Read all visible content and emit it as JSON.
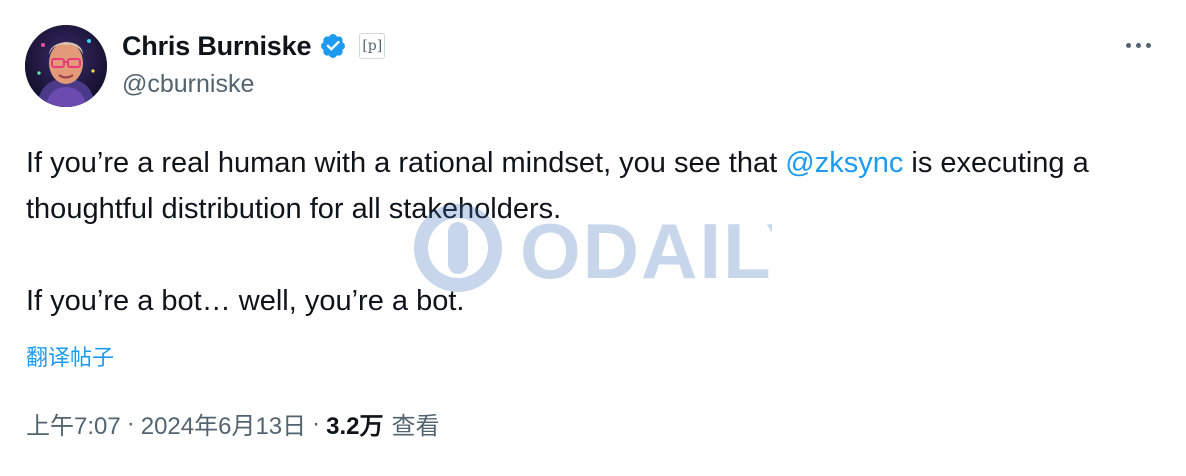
{
  "author": {
    "display_name": "Chris Burniske",
    "handle": "@cburniske",
    "affiliate_badge": "[p]",
    "verified_icon": "verified-badge-icon",
    "avatar_icon": "avatar-portrait"
  },
  "more_icon": "more-horizontal-icon",
  "tweet": {
    "para1_before": "If you’re a real human with a rational mindset, you see that ",
    "para1_mention": "@zksync",
    "para1_after": " is executing a thoughtful distribution for all stakeholders.",
    "para2": "If you’re a bot… well, you’re a bot."
  },
  "translate_label": "翻译帖子",
  "meta": {
    "time": "上午7:07",
    "separator": "·",
    "date": "2024年6月13日",
    "views_count": "3.2万",
    "views_label": "查看"
  },
  "watermark": {
    "text": "ODAILY"
  },
  "colors": {
    "accent": "#1d9bf0",
    "text": "#0f1419",
    "secondary": "#536471",
    "watermark": "#3b6fb6"
  }
}
